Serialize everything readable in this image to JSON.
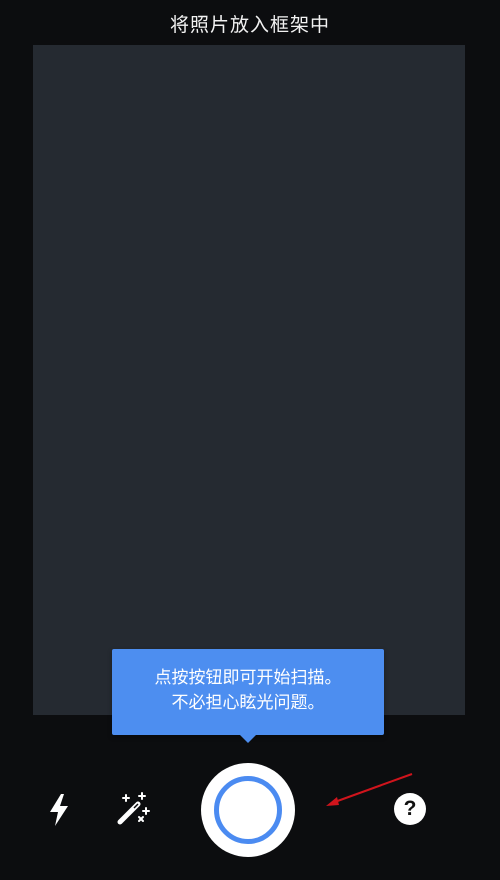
{
  "header": {
    "title": "将照片放入框架中"
  },
  "tooltip": {
    "line1": "点按按钮即可开始扫描。",
    "line2": "不必担心眩光问题。"
  },
  "toolbar": {
    "flash_icon": "flash-icon",
    "magic_icon": "magic-wand-icon",
    "shutter_icon": "shutter-icon",
    "help_label": "?"
  },
  "colors": {
    "background": "#0c0d0f",
    "frame": "#252a31",
    "accent": "#4d8ef0",
    "annotation": "#d0141c"
  }
}
